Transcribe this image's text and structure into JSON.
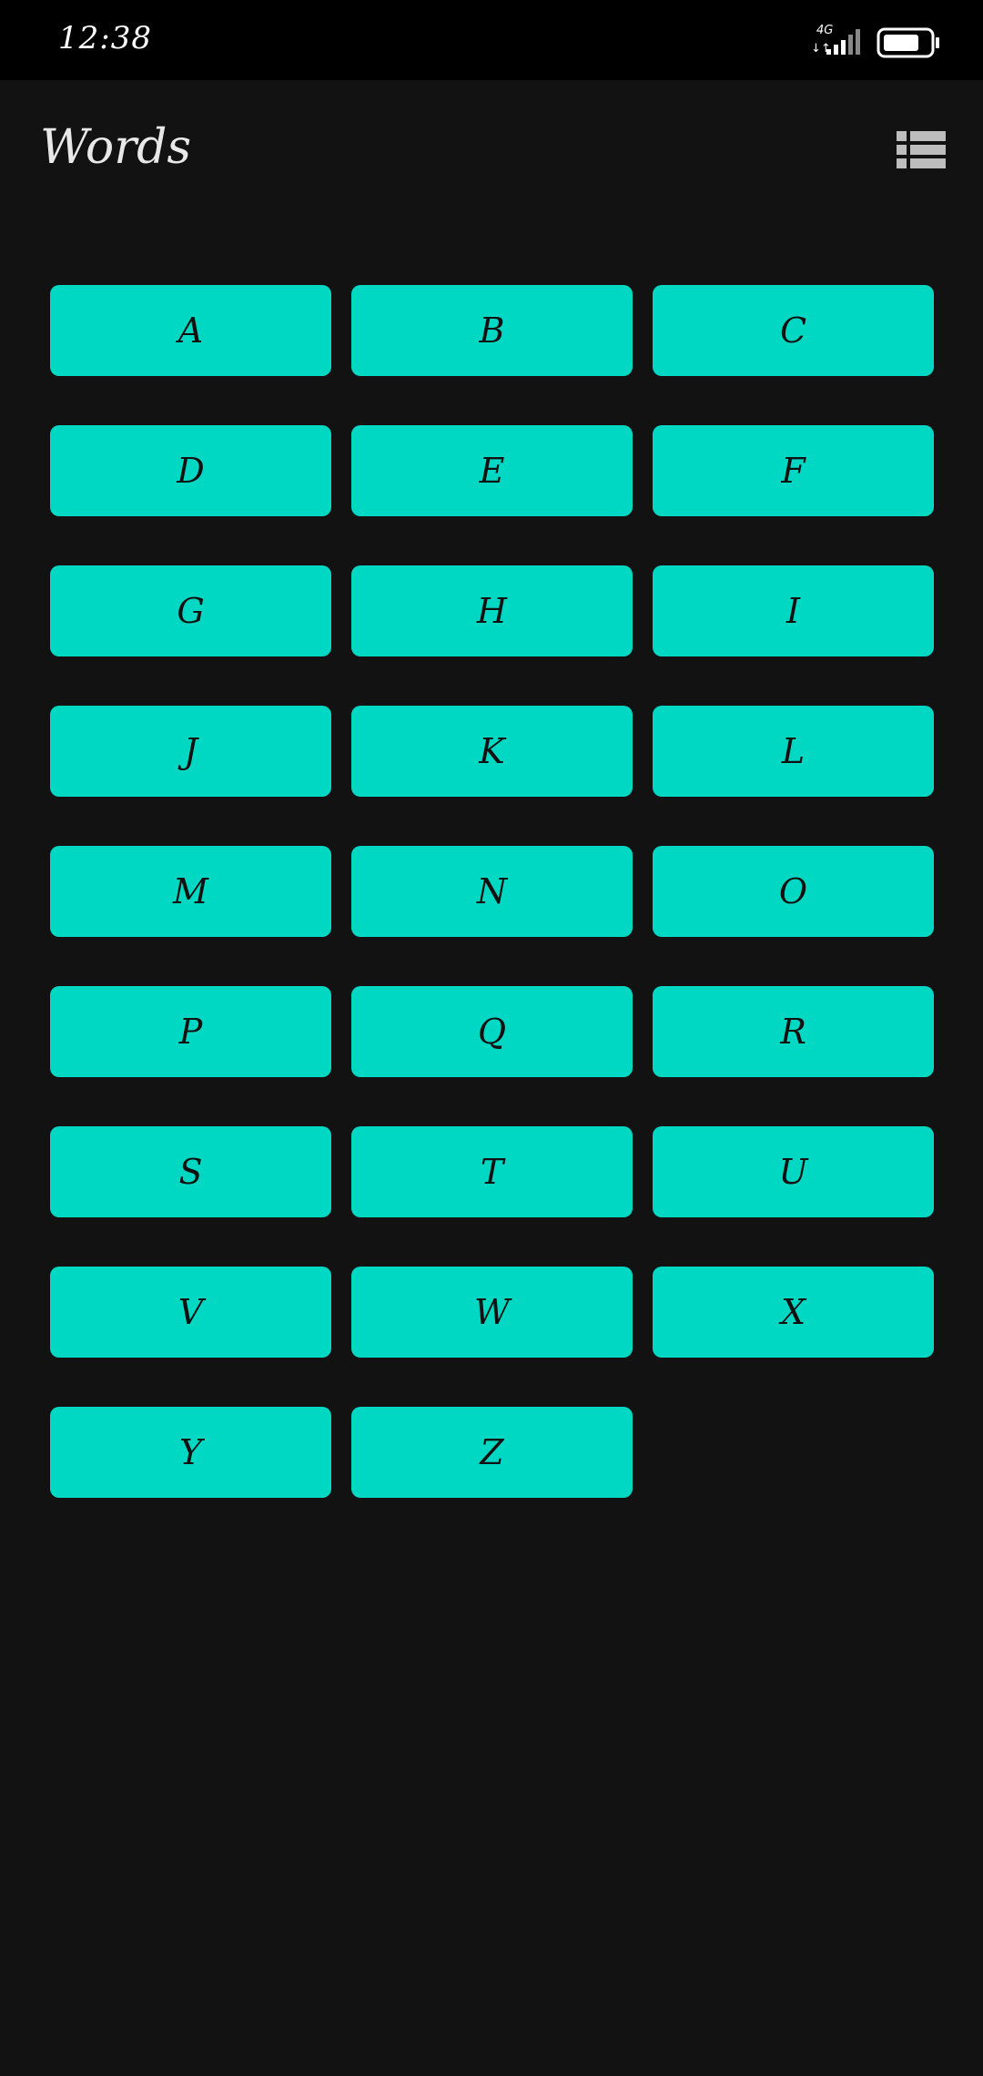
{
  "status_bar": {
    "time": "12:38",
    "network": "4G",
    "data_arrows": "↓↑"
  },
  "app_bar": {
    "title": "Words",
    "list_view_icon": "list-view-icon"
  },
  "letters": [
    "A",
    "B",
    "C",
    "D",
    "E",
    "F",
    "G",
    "H",
    "I",
    "J",
    "K",
    "L",
    "M",
    "N",
    "O",
    "P",
    "Q",
    "R",
    "S",
    "T",
    "U",
    "V",
    "W",
    "X",
    "Y",
    "Z"
  ],
  "colors": {
    "background": "#121212",
    "status_bar": "#000000",
    "button": "#00d8c4",
    "button_text": "#101010",
    "title_text": "#e8e8e8",
    "icon": "#bdbdbd"
  }
}
